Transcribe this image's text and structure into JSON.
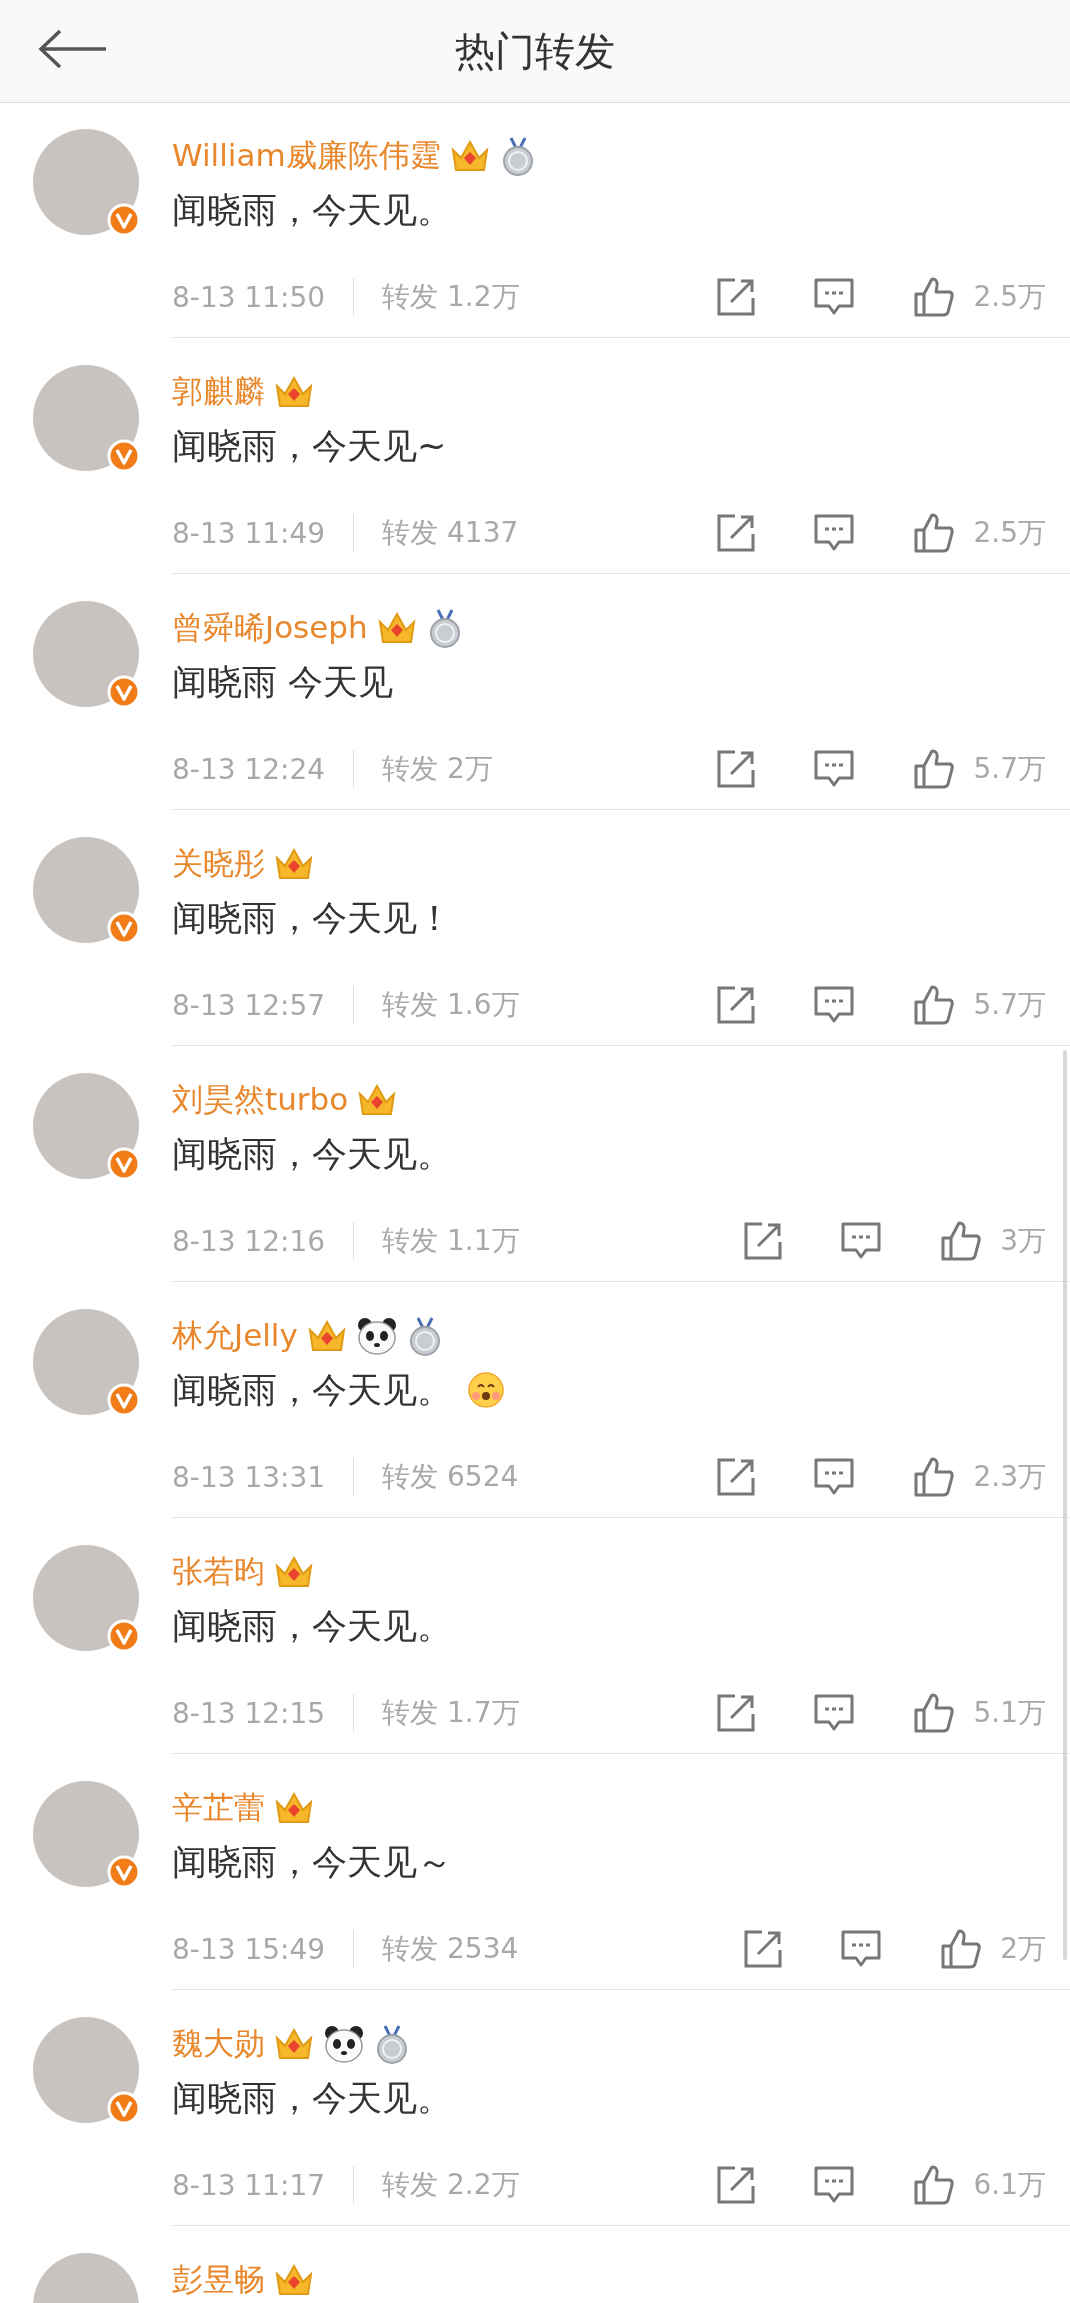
{
  "header": {
    "title": "热门转发"
  },
  "reposts": [
    {
      "name": "William威廉陈伟霆",
      "verified": true,
      "badges": [
        {
          "kind": "crown"
        },
        {
          "kind": "medal"
        }
      ],
      "text": "闻晓雨，今天见。",
      "time": "8-13 11:50",
      "repost_label": "转发",
      "repost_count": "1.2万",
      "likes": "2.5万"
    },
    {
      "name": "郭麒麟",
      "verified": true,
      "badges": [
        {
          "kind": "crown"
        }
      ],
      "text": "闻晓雨，今天见~",
      "time": "8-13 11:49",
      "repost_label": "转发",
      "repost_count": "4137",
      "likes": "2.5万"
    },
    {
      "name": "曾舜晞Joseph",
      "verified": true,
      "badges": [
        {
          "kind": "crown"
        },
        {
          "kind": "medal"
        }
      ],
      "text": "闻晓雨 今天见",
      "time": "8-13 12:24",
      "repost_label": "转发",
      "repost_count": "2万",
      "likes": "5.7万"
    },
    {
      "name": "关晓彤",
      "verified": true,
      "badges": [
        {
          "kind": "crown"
        }
      ],
      "text": "闻晓雨，今天见！",
      "time": "8-13 12:57",
      "repost_label": "转发",
      "repost_count": "1.6万",
      "likes": "5.7万"
    },
    {
      "name": "刘昊然turbo",
      "verified": true,
      "badges": [
        {
          "kind": "crown"
        }
      ],
      "text": "闻晓雨，今天见。",
      "time": "8-13 12:16",
      "repost_label": "转发",
      "repost_count": "1.1万",
      "likes": "3万"
    },
    {
      "name": "林允Jelly",
      "verified": true,
      "badges": [
        {
          "kind": "crown"
        },
        {
          "kind": "panda"
        },
        {
          "kind": "medal"
        }
      ],
      "text": "闻晓雨，今天见。",
      "text_emojis": [
        {
          "kind": "smile"
        }
      ],
      "time": "8-13 13:31",
      "repost_label": "转发",
      "repost_count": "6524",
      "likes": "2.3万"
    },
    {
      "name": "张若昀",
      "verified": true,
      "badges": [
        {
          "kind": "crown"
        }
      ],
      "text": "闻晓雨，今天见。",
      "time": "8-13 12:15",
      "repost_label": "转发",
      "repost_count": "1.7万",
      "likes": "5.1万"
    },
    {
      "name": "辛芷蕾",
      "verified": true,
      "badges": [
        {
          "kind": "crown"
        }
      ],
      "text": "闻晓雨，今天见～",
      "time": "8-13 15:49",
      "repost_label": "转发",
      "repost_count": "2534",
      "likes": "2万"
    },
    {
      "name": "魏大勋",
      "verified": true,
      "badges": [
        {
          "kind": "crown"
        },
        {
          "kind": "panda"
        },
        {
          "kind": "medal"
        }
      ],
      "text": "闻晓雨，今天见。",
      "time": "8-13 11:17",
      "repost_label": "转发",
      "repost_count": "2.2万",
      "likes": "6.1万"
    },
    {
      "name": "彭昱畅",
      "badges": [
        {
          "kind": "crown"
        }
      ]
    }
  ]
}
